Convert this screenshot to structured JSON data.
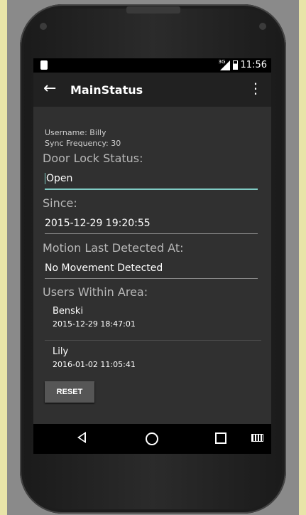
{
  "statusbar": {
    "network": "3G",
    "time": "11:56"
  },
  "toolbar": {
    "title": "MainStatus"
  },
  "status": {
    "username_line": "Username: Billy",
    "sync_line": "Sync Frequency: 30",
    "door_label": "Door Lock Status:",
    "door_value": "Open",
    "since_label": "Since:",
    "since_value": "2015-12-29 19:20:55",
    "motion_label": "Motion Last Detected At:",
    "motion_value": "No Movement Detected",
    "users_label": "Users Within Area:"
  },
  "users": [
    {
      "name": "Benski",
      "time": "2015-12-29 18:47:01"
    },
    {
      "name": "Lily",
      "time": "2016-01-02 11:05:41"
    }
  ],
  "actions": {
    "reset_label": "RESET"
  },
  "colors": {
    "accent": "#80cbc4",
    "toolbar": "#212121",
    "content_bg": "#303030"
  }
}
